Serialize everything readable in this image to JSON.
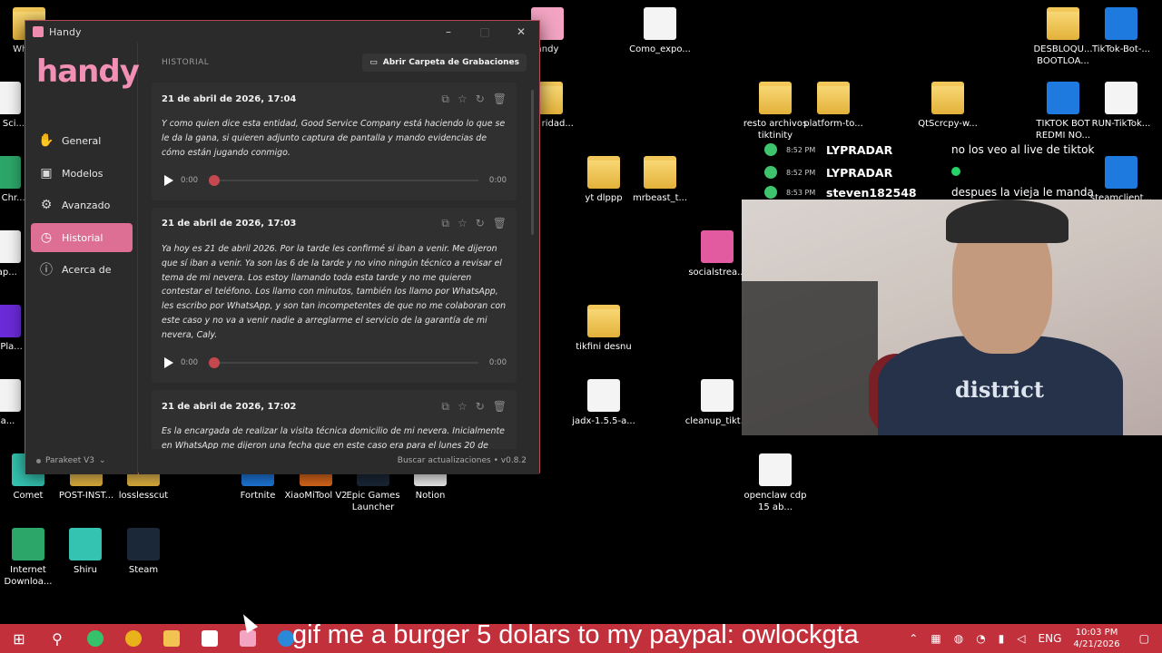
{
  "window": {
    "title": "Handy",
    "logo": "handy",
    "minimize": "–",
    "maximize": "□",
    "close": "✕"
  },
  "sidebar": {
    "items": [
      {
        "label": "General",
        "icon": "hand-icon"
      },
      {
        "label": "Modelos",
        "icon": "chip-icon"
      },
      {
        "label": "Avanzado",
        "icon": "gear-icon"
      },
      {
        "label": "Historial",
        "icon": "history-icon",
        "active": true
      },
      {
        "label": "Acerca de",
        "icon": "info-icon"
      }
    ],
    "model": "Parakeet V3"
  },
  "main": {
    "section_title": "HISTORIAL",
    "open_folder_label": "Abrir Carpeta de Grabaciones",
    "update_label": "Buscar actualizaciones",
    "version": "v0.8.2",
    "footer_separator": "•",
    "entries": [
      {
        "date": "21 de abril de 2026, 17:04",
        "text": "Y como quien dice esta entidad, Good Service Company está haciendo lo que se le da la gana, si quieren adjunto captura de pantalla y mando evidencias de cómo están jugando conmigo.",
        "time_start": "0:00",
        "time_end": "0:00"
      },
      {
        "date": "21 de abril de 2026, 17:03",
        "text": "Ya hoy es 21 de abril 2026. Por la tarde les confirmé si iban a venir. Me dijeron que sí iban a venir. Ya son las 6 de la tarde y no vino ningún técnico a revisar el tema de mi nevera. Los estoy llamando toda esta tarde y no me quieren contestar el teléfono. Los llamo con minutos, también los llamo por WhatsApp, les escribo por WhatsApp, y son tan incompetentes de que no me colaboran con este caso y no va a venir nadie a arreglarme el servicio de la garantía de mi nevera, Caly.",
        "time_start": "0:00",
        "time_end": "0:00"
      },
      {
        "date": "21 de abril de 2026, 17:02",
        "text": "Es la encargada de realizar la visita técnica domicilio de mi nevera. Inicialmente en WhatsApp me dijeron una fecha que en este caso era para el lunes 20 de",
        "time_start": "0:00",
        "time_end": "0:00"
      }
    ]
  },
  "desktop_icons": [
    {
      "label": "What...",
      "type": "folder"
    },
    {
      "label": "andy",
      "type": "appgray"
    },
    {
      "label": "Como_expo...",
      "type": "file"
    },
    {
      "label": "DESBLOQU... BOOTLOA...",
      "type": "folder"
    },
    {
      "label": "TikTok-Bot-...",
      "type": "appblue"
    },
    {
      "label": "opia ridad...",
      "type": "folder"
    },
    {
      "label": "resto archivos tiktinity",
      "type": "folder"
    },
    {
      "label": "platform-to...",
      "type": "folder"
    },
    {
      "label": "QtScrcpy-w...",
      "type": "folder"
    },
    {
      "label": "TIKTOK BOT REDMI NO...",
      "type": "appblue"
    },
    {
      "label": "RUN-TikTok...",
      "type": "file"
    },
    {
      "label": "yt dlppp",
      "type": "folder"
    },
    {
      "label": "mrbeast_t...",
      "type": "folder"
    },
    {
      "label": "socialstrea...",
      "type": "appteal"
    },
    {
      "label": "steamclient...",
      "type": "appblue"
    },
    {
      "label": "tikfini desnu",
      "type": "folder"
    },
    {
      "label": "jadx-1.5.5-a...",
      "type": "file"
    },
    {
      "label": "cleanup_tikt...",
      "type": "file"
    },
    {
      "label": "Comet",
      "type": "appteal"
    },
    {
      "label": "POST-INST...",
      "type": "folder"
    },
    {
      "label": "losslesscut",
      "type": "folder"
    },
    {
      "label": "Fortnite",
      "type": "appblue"
    },
    {
      "label": "XiaoMiTool V2",
      "type": "apporange"
    },
    {
      "label": "Epic Games Launcher",
      "type": "appdark"
    },
    {
      "label": "Notion",
      "type": "file"
    },
    {
      "label": "openclaw cdp 15 ab...",
      "type": "file"
    },
    {
      "label": "Internet Downloa...",
      "type": "appgreen"
    },
    {
      "label": "Shiru",
      "type": "appteal"
    },
    {
      "label": "Steam",
      "type": "appdark"
    },
    {
      "label": "Los Sci...",
      "type": "file"
    },
    {
      "label": "Ow Chr...",
      "type": "appgreen"
    },
    {
      "label": "Pap...",
      "type": "file"
    },
    {
      "label": "KMPla...",
      "type": "apporange"
    },
    {
      "label": "Ca...",
      "type": "file"
    }
  ],
  "chat": [
    {
      "time": "8:52 PM",
      "user": "LYPRADAR",
      "message": "no los veo al live de tiktok"
    },
    {
      "time": "8:52 PM",
      "user": "LYPRADAR",
      "message": ""
    },
    {
      "time": "8:53 PM",
      "user": "steven182548",
      "message": "despues la vieja le manda"
    }
  ],
  "webcam": {
    "shirt_text": "district"
  },
  "taskbar": {
    "marquee": "gif me a burger 5 dolars to my paypal: owlockgta",
    "language": "ENG",
    "time": "10:03 PM",
    "date": "4/21/2026",
    "accent": "#c2303c"
  }
}
